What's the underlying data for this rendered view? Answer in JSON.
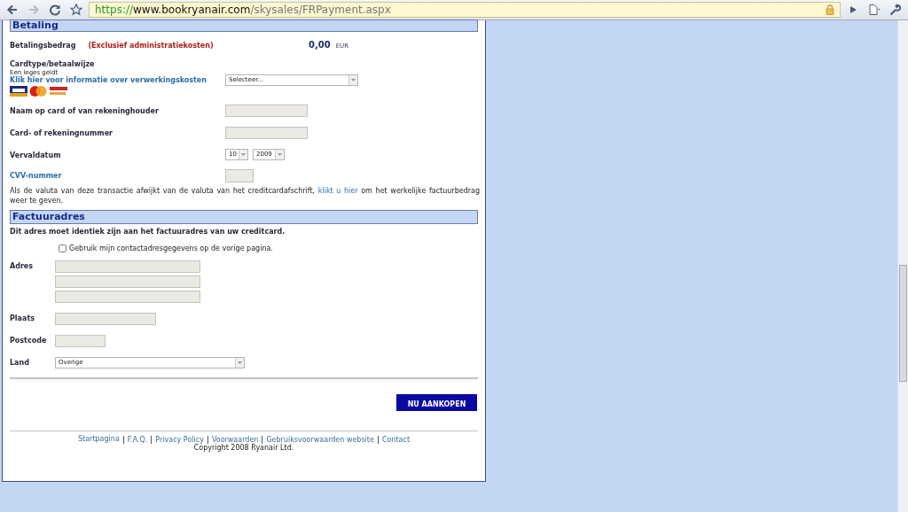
{
  "browser": {
    "url_scheme": "https://",
    "url_host": "www.bookryanair.com",
    "url_path": "/skysales/FRPayment.aspx",
    "secure": true
  },
  "payment": {
    "title": "Betaling",
    "amount_label": "Betalingsbedrag",
    "amount_note": "(Exclusief administratiekosten)",
    "amount": "0,00",
    "currency": "EUR",
    "card_label": "Cardtype/betaalwijze",
    "card_note": "Een leges geldt",
    "card_link": "Klik hier voor informatie over verwerkingskosten",
    "card_select": "Selecteer...",
    "name_label": "Naam op card of van rekeninghouder",
    "number_label": "Card- of rekeningnummer",
    "expiry_label": "Vervaldatum",
    "expiry_month": "10",
    "expiry_year": "2009",
    "cvv_label": "CVV-nummer",
    "notice_before": "Als de valuta van deze transactie afwijkt van de valuta van het creditcardafschrift,",
    "notice_link": "klikt u hier",
    "notice_after": "om het werkelijke factuurbedrag weer te geven."
  },
  "billing": {
    "title": "Factuuradres",
    "intro": "Dit adres moet identiek zijn aan het factuuradres van uw creditcard.",
    "use_contact": {
      "label": "Gebruik mijn contactadresgegevens op de vorige pagina.",
      "checked": false
    },
    "address_label": "Adres",
    "city_label": "Plaats",
    "postcode_label": "Postcode",
    "country_label": "Land",
    "country_value": "Overige"
  },
  "buy_button": "NU AANKOPEN",
  "footer": {
    "links": [
      "Startpagina",
      "F.A.Q.",
      "Privacy Policy",
      "Voorwaarden",
      "Gebruiksvoorwaarden website",
      "Contact"
    ],
    "copyright": "Copyright 2008 Ryanair Ltd."
  }
}
